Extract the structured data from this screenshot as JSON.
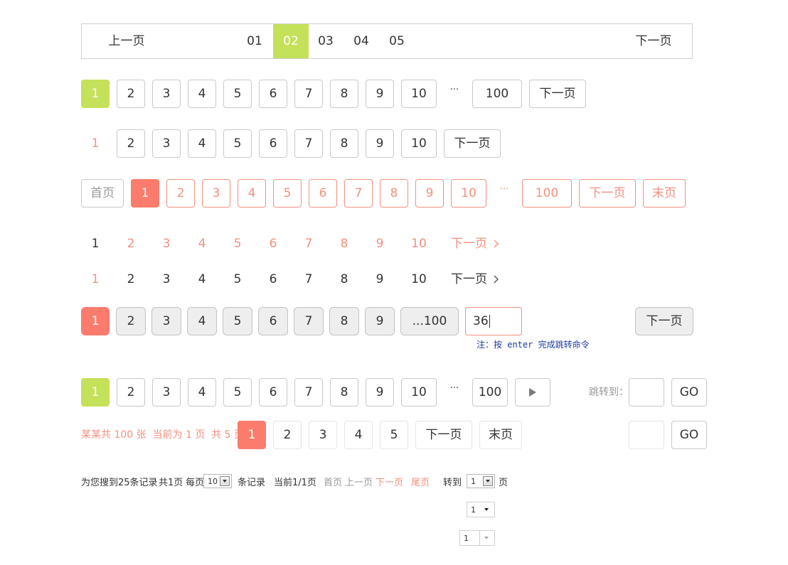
{
  "p1": {
    "prev": "上一页",
    "pages": [
      "01",
      "02",
      "03",
      "04",
      "05"
    ],
    "next": "下一页"
  },
  "p2": {
    "pages": [
      "1",
      "2",
      "3",
      "4",
      "5",
      "6",
      "7",
      "8",
      "9",
      "10"
    ],
    "ellipsis": "···",
    "last": "100",
    "next": "下一页"
  },
  "p3": {
    "pages": [
      "1",
      "2",
      "3",
      "4",
      "5",
      "6",
      "7",
      "8",
      "9",
      "10"
    ],
    "next": "下一页"
  },
  "p4": {
    "first": "首页",
    "pages": [
      "1",
      "2",
      "3",
      "4",
      "5",
      "6",
      "7",
      "8",
      "9",
      "10"
    ],
    "ellipsis": "···",
    "last": "100",
    "next": "下一页",
    "end": "末页"
  },
  "p5": {
    "pages": [
      "1",
      "2",
      "3",
      "4",
      "5",
      "6",
      "7",
      "8",
      "9",
      "10"
    ],
    "next": "下一页"
  },
  "p6": {
    "pages": [
      "1",
      "2",
      "3",
      "4",
      "5",
      "6",
      "7",
      "8",
      "9",
      "10"
    ],
    "next": "下一页"
  },
  "p7": {
    "pages": [
      "1",
      "2",
      "3",
      "4",
      "5",
      "6",
      "7",
      "8",
      "9"
    ],
    "last": "...100",
    "input_value": "36",
    "next": "下一页",
    "note": "注：按 enter 完成跳转命令"
  },
  "p8": {
    "pages": [
      "1",
      "2",
      "3",
      "4",
      "5",
      "6",
      "7",
      "8",
      "9",
      "10"
    ],
    "ellipsis": "···",
    "last": "100",
    "jump_label": "跳转到：",
    "go": "GO"
  },
  "p9": {
    "info": "某某共 100 张  当前为 1 页  共 5 页",
    "pages": [
      "1",
      "2",
      "3",
      "4",
      "5"
    ],
    "next": "下一页",
    "end": "末页",
    "go": "GO"
  },
  "p10": {
    "found": "为您搜到25条记录",
    "total_pages": "共1页",
    "per_page": "每页",
    "per_page_value": "10",
    "records": "条记录",
    "current": "当前1/1页",
    "first": "首页",
    "prev": "上一页",
    "next": "下一页",
    "last": "尾页",
    "goto": "转到",
    "goto_value": "1",
    "page_unit": "页"
  },
  "sel1": {
    "value": "1"
  },
  "sel2": {
    "value": "1"
  },
  "colors": {
    "green": "#c4e15a",
    "salmon": "#fb7c6c",
    "salmon_text": "#f3907f",
    "note_blue": "#1b3a9e"
  }
}
